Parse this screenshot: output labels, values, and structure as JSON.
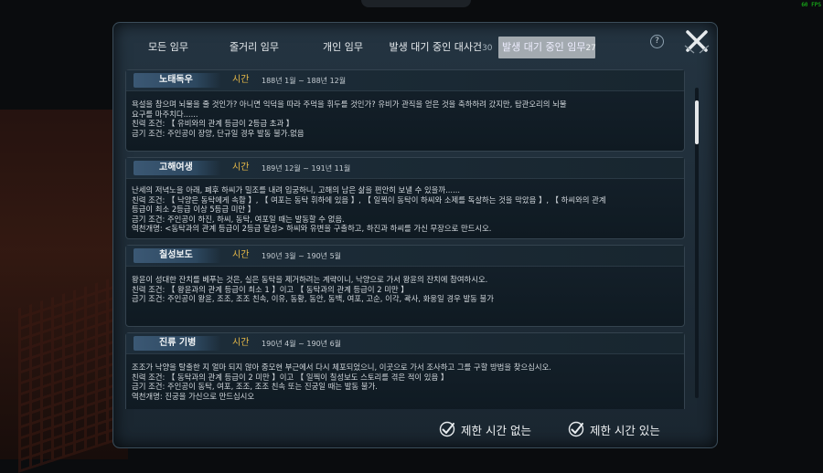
{
  "fps_text": "60 FPS",
  "tabs": [
    {
      "label": "모든 임무",
      "count": ""
    },
    {
      "label": "줄거리 임무",
      "count": ""
    },
    {
      "label": "개인 임무",
      "count": ""
    },
    {
      "label": "발생 대기 중인 대사건",
      "count": "30"
    },
    {
      "label": "발생 대기 중인 임무",
      "count": "27"
    }
  ],
  "active_tab": 4,
  "help_label": "?",
  "time_label": "시간",
  "cards": [
    {
      "name": "노태독우",
      "time_range": "188년 1월 ~ 188년 12월",
      "lines": [
        "욕설을 참으며 뇌물을 줄 것인가? 아니면 익덕을 따라 주먹을 휘두를 것인가? 유비가 관직을 얻은 것을 축하하려 갔지만, 탐관오리의 뇌물",
        "요구를 마주치다......",
        "친력 조건: 【 유비와의 관계 등급이 2등급 초과 】",
        "금기 조건: 주인공이 장양, 단규일 경우 발동 불가.없음"
      ]
    },
    {
      "name": "고해여생",
      "time_range": "189년 12월 ~ 191년 11월",
      "lines": [
        "난세의 저녁노을 아래, 폐후 하씨가 밀조를 내려 입궁하니, 고해의 남은 삶을 편안히 보낼 수 있을까......",
        "친력 조건: 【 낙양은 동탁에게 속함 】, 【 여포는 동탁 휘하에 있음 】, 【 일찍이 동탁이 하씨와 소제를 독살하는 것을 막았음 】, 【 하씨와의 관계",
        "등급이 최소 2등급 이상 5등급 미만 】",
        "금기 조건: 주인공이 하진, 하씨, 동탁, 여포일 때는 발동할 수 없음.",
        "역천개명: <동탁과의 관계 등급이 2등급 달성> 하씨와 유변을 구출하고, 하진과 하씨를 가신 무장으로 만드시오."
      ]
    },
    {
      "name": "칠성보도",
      "time_range": "190년 3월 ~ 190년 5월",
      "lines": [
        "왕윤이 성대한 잔치를 베푸는 것은, 실은 동탁을 제거하려는 계략이니, 낙양으로 가서 왕윤의 잔치에 참여하시오.",
        "친력 조건: 【 왕윤과의 관계 등급이 최소 1 】이고 【 동탁과의 관계 등급이 2 미만 】",
        "금기 조건: 주인공이 왕윤, 조조, 조조 친속, 이유, 동황, 동안, 동백, 여포, 고순, 이각, 곽사, 화웅일 경우 발동 불가"
      ]
    },
    {
      "name": "진류 기병",
      "time_range": "190년 4월 ~ 190년 6월",
      "lines": [
        "조조가 낙양을 탈출한 지 얼마 되지 않아 중모현 부근에서 다시 체포되었으니, 이곳으로 가서 조사하고 그를 구할 방법을 찾으십시오.",
        "친력 조건: 【 동탁과의 관계 등급이 2 미만 】이고 【 일찍이 칠성보도 스토리를 겪은 적이 있음 】",
        "금기 조건: 주인공이 동탁, 여포, 조조, 조조 친속 또는 진궁일 때는 발동 불가.",
        "역천개명: 진궁을 가신으로 만드십시오"
      ]
    }
  ],
  "filters": [
    {
      "label": "제한 시간 없는",
      "checked": true
    },
    {
      "label": "제한 시간 있는",
      "checked": true
    }
  ],
  "colors": {
    "accent_gold": "#e4b848",
    "panel_bg": "#1f2e39",
    "name_plate": "#3b5874"
  }
}
